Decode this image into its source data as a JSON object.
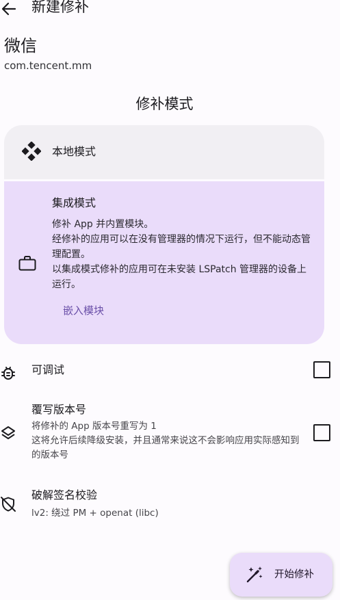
{
  "header": {
    "title": "新建修补",
    "back_icon": "arrow-back-icon"
  },
  "app": {
    "name": "微信",
    "package": "com.tencent.mm"
  },
  "patch_mode": {
    "title": "修补模式",
    "local": {
      "label": "本地模式",
      "icon": "local-mode-icon"
    },
    "integrated": {
      "label": "集成模式",
      "icon": "briefcase-icon",
      "description": "修补 App 并内置模块。\n经修补的应用可以在没有管理器的情况下运行，但不能动态管理配置。\n以集成模式修补的应用可在未安装 LSPatch 管理器的设备上运行。",
      "embed_button": "嵌入模块",
      "selected": true
    }
  },
  "options": {
    "debuggable": {
      "title": "可调试",
      "icon": "bug-icon",
      "checked": false
    },
    "override_version": {
      "title": "覆写版本号",
      "description": "将修补的 App 版本号重写为 1\n这将允许后续降级安装，并且通常来说这不会影响应用实际感知到的版本号",
      "icon": "layers-icon",
      "checked": false
    },
    "signature_bypass": {
      "title": "破解签名校验",
      "description": "lv2: 绕过 PM + openat (libc)",
      "icon": "shield-off-icon"
    }
  },
  "fab": {
    "label": "开始修补",
    "icon": "magic-wand-icon"
  },
  "colors": {
    "background": "#fdfbfe",
    "card_local": "#f1eff3",
    "card_selected": "#eadcfa",
    "accent_text": "#6a4fa8"
  }
}
